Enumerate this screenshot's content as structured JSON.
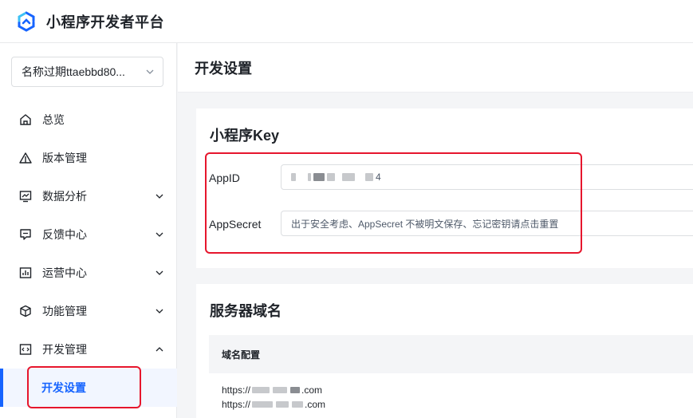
{
  "header": {
    "app_title": "小程序开发者平台"
  },
  "sidebar": {
    "app_selector": "名称过期ttaebbd80...",
    "items": [
      {
        "label": "总览",
        "icon": "home-icon",
        "expandable": false
      },
      {
        "label": "版本管理",
        "icon": "warning-triangle-icon",
        "expandable": false
      },
      {
        "label": "数据分析",
        "icon": "chart-monitor-icon",
        "expandable": true
      },
      {
        "label": "反馈中心",
        "icon": "feedback-icon",
        "expandable": true
      },
      {
        "label": "运营中心",
        "icon": "operations-chart-icon",
        "expandable": true
      },
      {
        "label": "功能管理",
        "icon": "cube-icon",
        "expandable": true
      },
      {
        "label": "开发管理",
        "icon": "code-icon",
        "expandable": true,
        "expanded": true
      }
    ],
    "active_sub": "开发设置"
  },
  "main": {
    "page_title": "开发设置",
    "key_section": {
      "title": "小程序Key",
      "appid_label": "AppID",
      "appid_value_tail": "4",
      "appsecret_label": "AppSecret",
      "appsecret_placeholder": "出于安全考虑、AppSecret 不被明文保存、忘记密钥请点击重置"
    },
    "domain_section": {
      "title": "服务器域名",
      "table_header": "域名配置",
      "url1_prefix": "https://",
      "url1_suffix": ".com",
      "url2_prefix": "https://",
      "url2_suffix": ".com"
    }
  },
  "colors": {
    "accent": "#1664ff",
    "highlight_red": "#e6162d"
  }
}
